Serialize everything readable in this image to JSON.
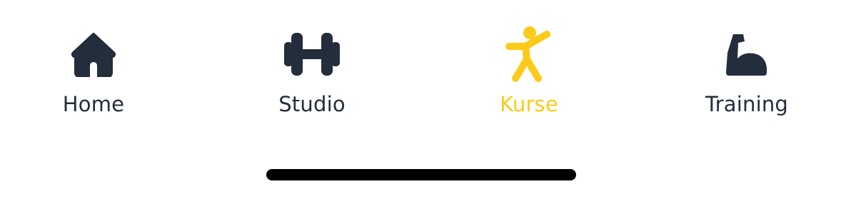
{
  "tabbar": {
    "colors": {
      "inactive": "#232d3b",
      "active": "#fccb1a",
      "background": "#ffffff",
      "home_indicator": "#000000"
    },
    "active_tab": "Kurse",
    "items": [
      {
        "label": "Home",
        "icon": "home-icon"
      },
      {
        "label": "Studio",
        "icon": "dumbbell-icon"
      },
      {
        "label": "Kurse",
        "icon": "person-stretching-icon"
      },
      {
        "label": "Training",
        "icon": "flexed-biceps-icon"
      }
    ]
  }
}
